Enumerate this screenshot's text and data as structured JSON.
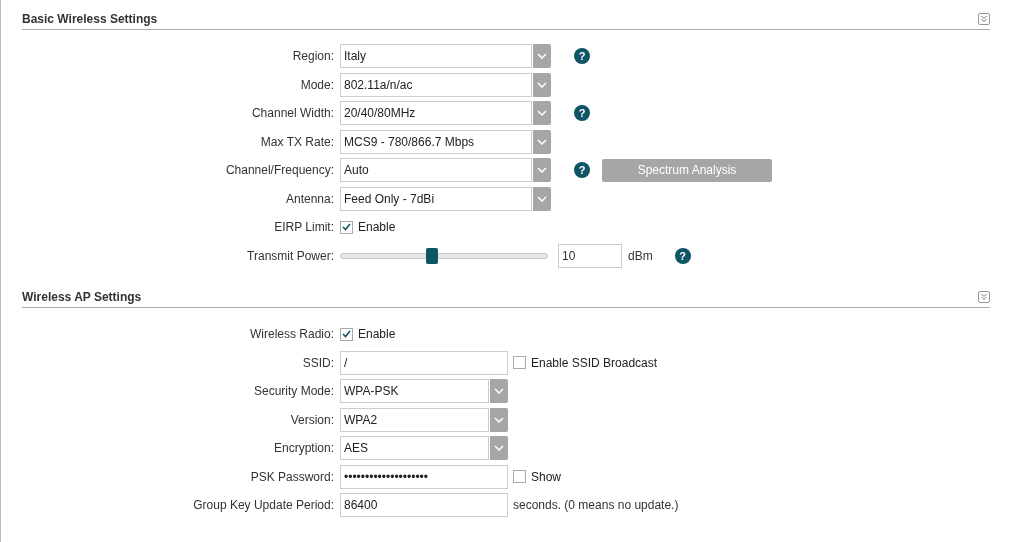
{
  "sections": [
    {
      "title": "Basic Wireless Settings",
      "fields": [
        {
          "kind": "select",
          "label": "Region:",
          "value": "Italy",
          "help": "?"
        },
        {
          "kind": "select",
          "label": "Mode:",
          "value": "802.11a/n/ac"
        },
        {
          "kind": "select",
          "label": "Channel Width:",
          "value": "20/40/80MHz",
          "help": "?"
        },
        {
          "kind": "select",
          "label": "Max TX Rate:",
          "value": "MCS9 - 780/866.7 Mbps"
        },
        {
          "kind": "select",
          "label": "Channel/Frequency:",
          "value": "Auto",
          "help": "?",
          "button": {
            "label": "Spectrum Analysis",
            "disabled": true
          }
        },
        {
          "kind": "select",
          "label": "Antenna:",
          "value": "Feed Only - 7dBi"
        },
        {
          "kind": "checkbox",
          "label": "EIRP Limit:",
          "option": "Enable",
          "checked": true
        },
        {
          "kind": "slider",
          "label": "Transmit Power:",
          "level": 0.44,
          "value": "10",
          "unit": "dBm",
          "help": "?"
        }
      ]
    },
    {
      "title": "Wireless AP Settings",
      "fields": [
        {
          "kind": "checkbox",
          "label": "Wireless Radio:",
          "option": "Enable",
          "checked": true
        },
        {
          "kind": "text",
          "label": "SSID:",
          "value": "/",
          "option": "Enable SSID Broadcast",
          "checked": false
        },
        {
          "kind": "select",
          "label": "Security Mode:",
          "value": "WPA-PSK"
        },
        {
          "kind": "select",
          "label": "Version:",
          "value": "WPA2"
        },
        {
          "kind": "select",
          "label": "Encryption:",
          "value": "AES"
        },
        {
          "kind": "text",
          "label": "PSK Password:",
          "value": "••••••••••••••••••••",
          "option": "Show",
          "checked": false
        },
        {
          "kind": "text",
          "label": "Group Key Update Period:",
          "value": "86400",
          "note": "seconds. (0 means no update.)"
        }
      ]
    }
  ]
}
